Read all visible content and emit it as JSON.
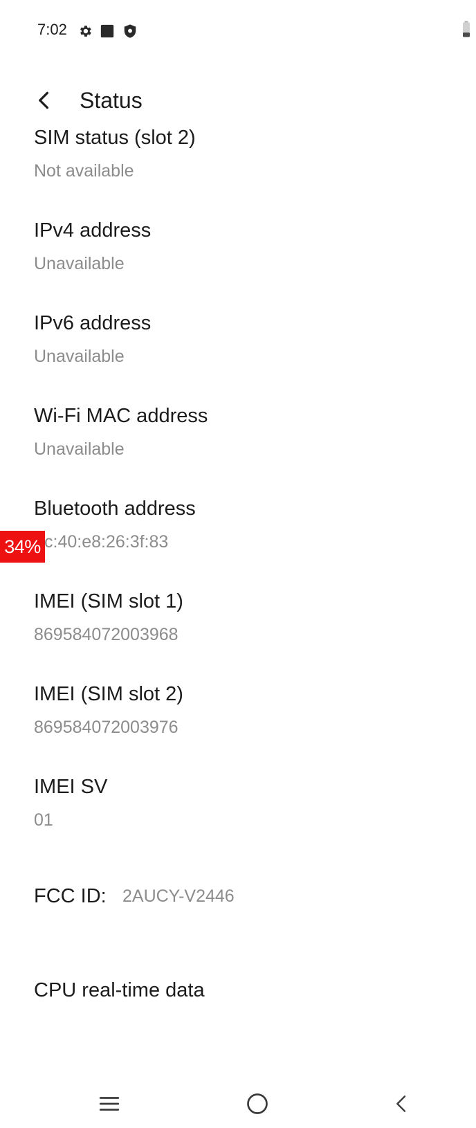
{
  "status_bar": {
    "time": "7:02",
    "icons": [
      "gear-icon",
      "square-icon",
      "shield-icon",
      "battery-icon"
    ]
  },
  "toolbar": {
    "back_icon": "chevron-left-icon",
    "title": "Status"
  },
  "items": [
    {
      "title": "SIM status (slot 2)",
      "value": "Not available"
    },
    {
      "title": "IPv4 address",
      "value": "Unavailable"
    },
    {
      "title": "IPv6 address",
      "value": "Unavailable"
    },
    {
      "title": "Wi-Fi MAC address",
      "value": "Unavailable"
    },
    {
      "title": "Bluetooth address",
      "value": "c:40:e8:26:3f:83"
    },
    {
      "title": "IMEI (SIM slot 1)",
      "value": "869584072003968"
    },
    {
      "title": "IMEI (SIM slot 2)",
      "value": "869584072003976"
    },
    {
      "title": "IMEI SV",
      "value": "01"
    }
  ],
  "fcc": {
    "label": "FCC ID:",
    "value": "2AUCY-V2446"
  },
  "cpu_item": {
    "title": "CPU real-time data"
  },
  "overlay": {
    "text": "34%",
    "color": "#ee1111"
  },
  "nav_bar": {
    "icons": [
      "menu-icon",
      "home-circle-icon",
      "back-chevron-icon"
    ]
  }
}
